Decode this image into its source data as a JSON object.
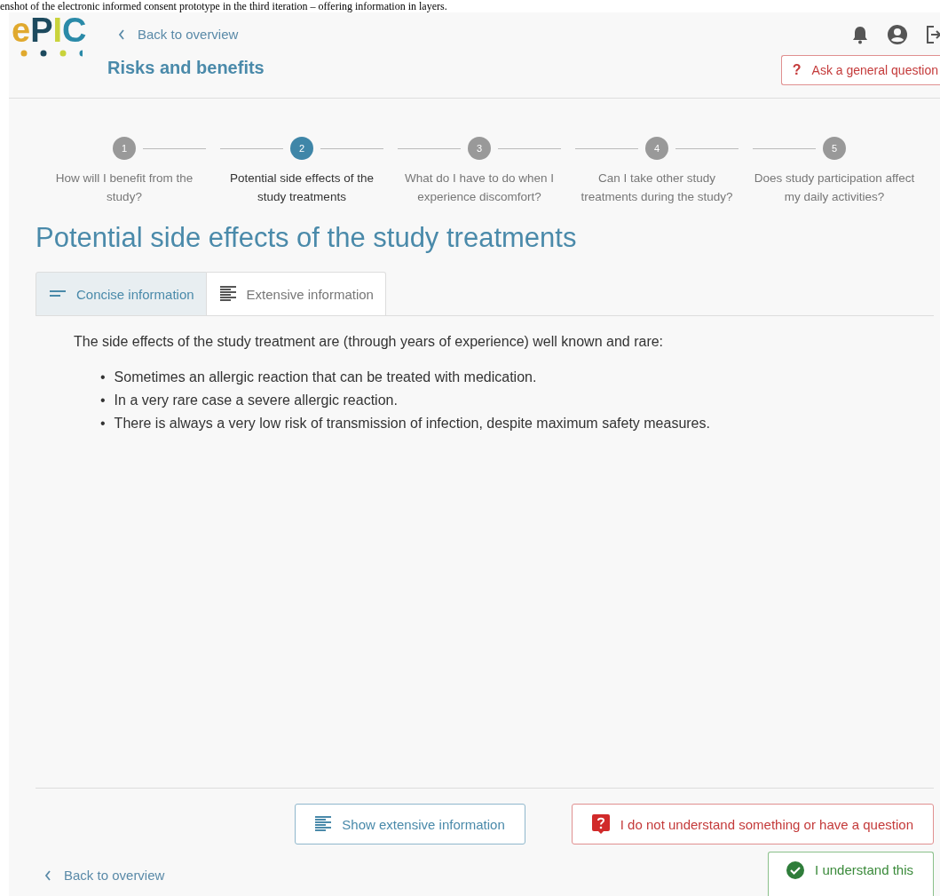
{
  "caption": "enshot of the electronic informed consent prototype in the third iteration – offering information in layers.",
  "header": {
    "logo": "ePIC",
    "back_link": "Back to overview",
    "title": "Risks and benefits",
    "ask_button": "Ask a general question",
    "ask_icon": "?"
  },
  "steps": [
    {
      "number": "1",
      "label": "How will I benefit from the study?",
      "selected": false
    },
    {
      "number": "2",
      "label": "Potential side effects of the study treatments",
      "selected": true
    },
    {
      "number": "3",
      "label": "What do I have to do when I experience discomfort?",
      "selected": false
    },
    {
      "number": "4",
      "label": "Can I take other study treatments during the study?",
      "selected": false
    },
    {
      "number": "5",
      "label": "Does study participation affect my daily activities?",
      "selected": false
    }
  ],
  "heading": "Potential side effects of the study treatments",
  "tabs": [
    {
      "kind": "concise",
      "label": "Concise information",
      "selected": true
    },
    {
      "kind": "extensive",
      "label": "Extensive information",
      "selected": false
    }
  ],
  "intro": "The side effects of the study treatment are (through years of experience) well known and rare:",
  "bullets": [
    {
      "marker": "•",
      "text": "Sometimes an allergic reaction that can be treated with medication."
    },
    {
      "marker": "•",
      "text": "In a very rare case a severe allergic reaction."
    },
    {
      "marker": "•",
      "text": "There is always a very low risk of transmission of infection, despite maximum safety measures."
    }
  ],
  "footer": {
    "extensive_button": "Show extensive information",
    "question_button": "I do not understand something or have a question",
    "back_link": "Back to overview",
    "understand_button": "I understand this"
  }
}
